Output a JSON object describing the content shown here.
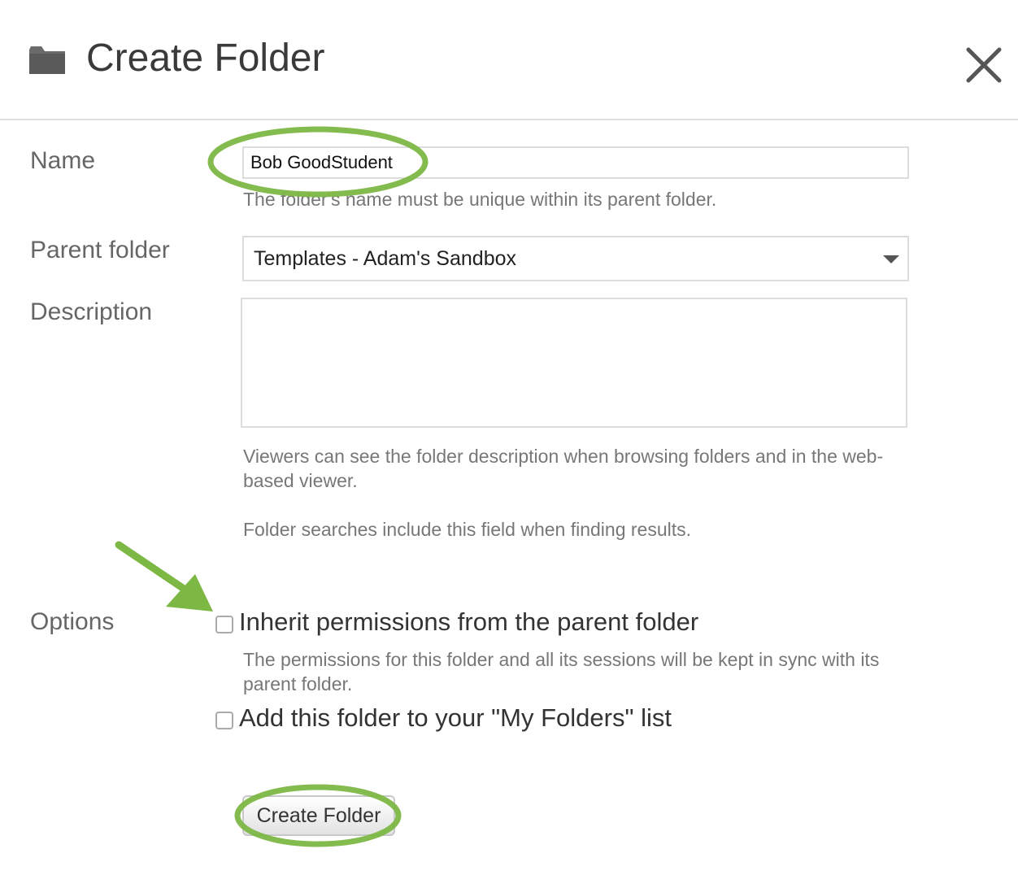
{
  "dialog": {
    "title": "Create Folder",
    "icons": {
      "folder": "folder-icon",
      "close": "close-icon"
    }
  },
  "form": {
    "name": {
      "label": "Name",
      "value": "Bob GoodStudent",
      "hint": "The folder's name must be unique within its parent folder."
    },
    "parent_folder": {
      "label": "Parent folder",
      "selected": "Templates - Adam's Sandbox"
    },
    "description": {
      "label": "Description",
      "value": "",
      "hint_1": "Viewers can see the folder description when browsing folders and in the web-based viewer.",
      "hint_2": "Folder searches include this field when finding results."
    },
    "options": {
      "label": "Options",
      "inherit_permissions": {
        "label": "Inherit permissions from the parent folder",
        "checked": false,
        "hint": "The permissions for this folder and all its sessions will be kept in sync with its parent folder."
      },
      "add_to_my_folders": {
        "label": "Add this folder to your \"My Folders\" list",
        "checked": false
      }
    },
    "submit_label": "Create Folder"
  },
  "colors": {
    "annotation_green": "#7db744",
    "title_text": "#3a3a3a",
    "label_text": "#666666",
    "hint_text": "#777777"
  }
}
